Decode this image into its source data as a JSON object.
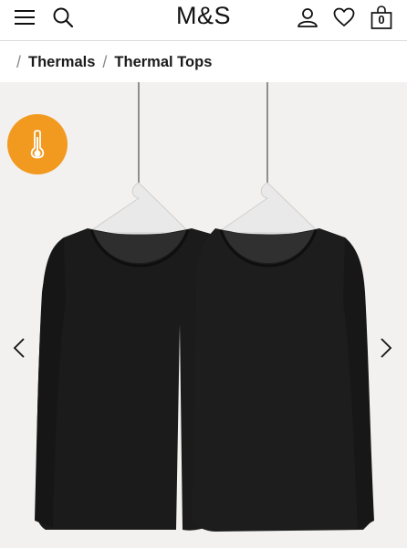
{
  "header": {
    "logo": "M&S",
    "bag_count": "0",
    "icons": [
      "menu-icon",
      "search-icon",
      "account-icon",
      "wishlist-heart-icon",
      "shopping-bag-icon"
    ]
  },
  "breadcrumb": {
    "items": [
      "Thermals",
      "Thermal Tops"
    ]
  },
  "gallery": {
    "badge_icon": "thermometer-icon",
    "badge_color": "#f29a1f",
    "background_color": "#f2f1ef",
    "garment_color": "#1b1b1b"
  }
}
